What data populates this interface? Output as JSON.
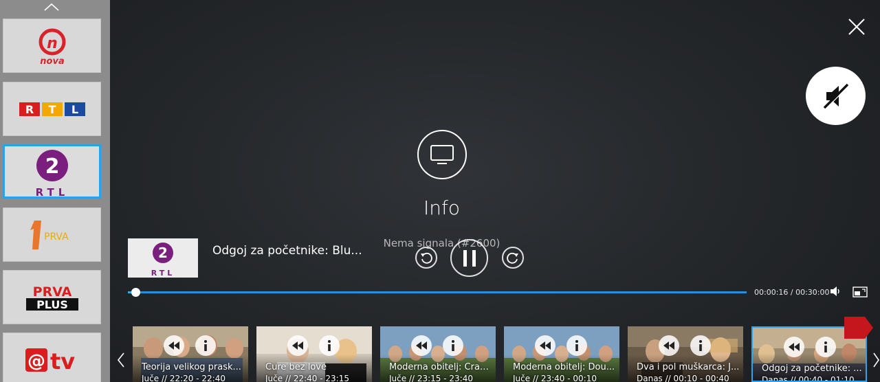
{
  "sidebar": {
    "channels": [
      {
        "name": "nova",
        "logo_text": "nova",
        "selected": false
      },
      {
        "name": "RTL",
        "logo_text": "RTL",
        "selected": false
      },
      {
        "name": "RTL 2",
        "logo_number": "2",
        "logo_text": "RTL",
        "selected": true
      },
      {
        "name": "PRVA",
        "logo_text": "PRVA",
        "selected": false
      },
      {
        "name": "PRVA PLUS",
        "logo_line1": "PRVA",
        "logo_line2": "PLUS",
        "selected": false
      },
      {
        "name": "@tv",
        "logo_text": "tv",
        "selected": false
      }
    ]
  },
  "player": {
    "overlay_title": "Info",
    "signal_message": "Nema signala  (#2600)",
    "current_channel_number": "2",
    "current_channel_text": "RTL",
    "current_title": "Odgoj za početnike: Blu...",
    "time_display": "00:00:16 / 00:30:00",
    "progress": 0.012,
    "muted": true
  },
  "colors": {
    "accent": "#29a3e8",
    "flag": "#c4161c",
    "rtl2_purple": "#7a1f7d"
  },
  "strip": {
    "items": [
      {
        "title": "Teorija velikog prask...",
        "time": "Juče // 22:20 - 22:40",
        "selected": false
      },
      {
        "title": "Cure bez love",
        "time": "Juče // 22:40 - 23:15",
        "selected": false
      },
      {
        "title": "Moderna obitelj: Craz...",
        "time": "Juče // 23:15 - 23:40",
        "selected": false
      },
      {
        "title": "Moderna obitelj: Dou...",
        "time": "Juče // 23:40 - 00:10",
        "selected": false
      },
      {
        "title": "Dva i pol muškarca: J...",
        "time": "Danas // 00:10 - 00:40",
        "selected": false
      },
      {
        "title": "Odgoj za početnike: ...",
        "time": "Danas // 00:40 - 01:10",
        "selected": true
      }
    ]
  },
  "icons": [
    "chevron-up-icon",
    "close-icon",
    "mute-icon",
    "tv-icon",
    "replay-icon",
    "pause-icon",
    "forward-icon",
    "volume-icon",
    "pip-icon",
    "rewind-icon",
    "info-icon",
    "chevron-left-icon",
    "chevron-right-icon"
  ]
}
